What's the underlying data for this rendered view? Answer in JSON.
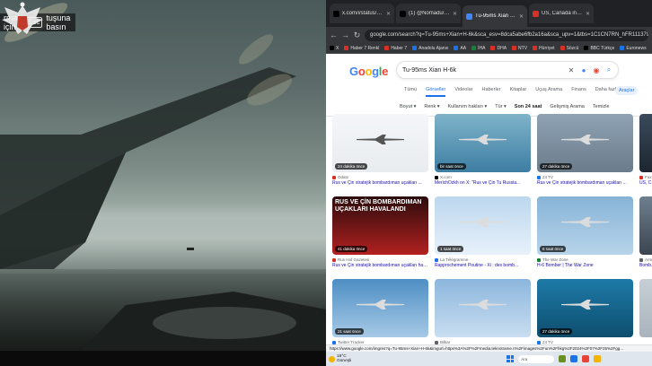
{
  "video": {
    "esc_hint_prefix": "rmak için",
    "esc_key": "Esc",
    "esc_hint_suffix": "tuşuna basın"
  },
  "browser": {
    "tabs": [
      {
        "label": "x.com/i/status/17479...",
        "favicon_color": "#000000",
        "active": false
      },
      {
        "label": "(1) @Nomadu/Türk basını / X",
        "favicon_color": "#000000",
        "active": false
      },
      {
        "label": "Tu-95ms Xian H-6k - Google G...",
        "favicon_color": "#4285f4",
        "active": true
      },
      {
        "label": "US, Canada intercept nuclear-...",
        "favicon_color": "#d93025",
        "active": false
      }
    ],
    "url": "google.com/search?q=Tu-95ms+Xian+H-6k&sca_esv=8dca5abe6fb2a16a&sca_upv=1&tbs=1C1CN7RN_hFR1113791113&udm=2&biw=1536",
    "bookmarks": [
      {
        "label": "X",
        "color": "#000000"
      },
      {
        "label": "Haber 7 Renkl",
        "color": "#d93025"
      },
      {
        "label": "Haber 7",
        "color": "#d93025"
      },
      {
        "label": "Anadolu Ajansı",
        "color": "#1a73e8"
      },
      {
        "label": "AA",
        "color": "#1a73e8"
      },
      {
        "label": "İHA",
        "color": "#188038"
      },
      {
        "label": "DHA",
        "color": "#d93025"
      },
      {
        "label": "NTV",
        "color": "#d93025"
      },
      {
        "label": "Hürriyet",
        "color": "#d93025"
      },
      {
        "label": "Sözcü",
        "color": "#d93025"
      },
      {
        "label": "BBC Türkçe",
        "color": "#000000"
      },
      {
        "label": "Euronews",
        "color": "#1a73e8"
      },
      {
        "label": "DW",
        "color": "#1a73e8"
      }
    ]
  },
  "google": {
    "logo": [
      "G",
      "o",
      "o",
      "g",
      "l",
      "e"
    ],
    "logo_colors": [
      "#4285f4",
      "#ea4335",
      "#fbbc05",
      "#4285f4",
      "#34a853",
      "#ea4335"
    ],
    "query": "Tu-95ms Xian H-6k",
    "tabs": [
      "Tümü",
      "Görseller",
      "Videolar",
      "Haberler",
      "Kitaplar",
      "Uçuş Arama",
      "Finans",
      "Daha fazla"
    ],
    "active_tab": "Görseller",
    "tools_label": "Araçlar",
    "filters": [
      "Boyut",
      "Renk",
      "Kullanım hakları",
      "Tür",
      "Son 24 saat",
      "Gelişmiş Arama",
      "Temizle"
    ],
    "results": [
      {
        "badge": "24 dakika önce",
        "source": "Odatv",
        "title": "Rus ve Çin stratejik bombardıman uçakları ..."
      },
      {
        "badge": "bir saat önce",
        "source": "X.com",
        "title": "MerichOzkh on X: \"Rus ve Çin Tu Russia..."
      },
      {
        "badge": "27 dakika önce",
        "source": "24 TV",
        "title": "Rus ve Çin stratejik bombardıman uçakları ..."
      },
      {
        "badge": "",
        "source": "Fox",
        "title": "US, C..."
      },
      {
        "badge": "41 dakika önce",
        "source": "Rus Haf Gazetesi",
        "title": "Rus ve Çin stratejik bombardıman uçakları havalandı"
      },
      {
        "badge": "1 saat önce",
        "source": "La Télégramme",
        "title": "Rapprochement Poutine - Xi : des bomb..."
      },
      {
        "badge": "6 saat önce",
        "source": "The War Zone",
        "title": "H-6 Bomber | The War Zone"
      },
      {
        "badge": "",
        "source": "Arm",
        "title": "Bomb..."
      },
      {
        "badge": "21 saat önce",
        "source": "Twitter Tracker",
        "title": ""
      },
      {
        "badge": "",
        "source": "Bilkar",
        "title": ""
      },
      {
        "badge": "27 dakika önce",
        "source": "24 TV",
        "title": ""
      },
      {
        "badge": "",
        "source": "",
        "title": ""
      }
    ],
    "banner_text": "RUS VE ÇİN BOMBARDIMAN UÇAKLARI HAVALANDI"
  },
  "status_url": "https://www.google.com/imgres?q=Tu-95ms+Xian+H-6k&imgurl=https%3A%2F%2Fmedia.teknotrame.n%2Fimages%2Fun%2Fhkg%2F2024%2F07%2F25%2Fgg...",
  "taskbar": {
    "temp": "18°C",
    "weather": "Güneşli",
    "search_placeholder": "Ara"
  },
  "icons": {
    "emblem": "eagle-emblem-icon",
    "back": "back-arrow-icon",
    "forward": "forward-arrow-icon",
    "reload": "reload-icon",
    "clear": "close-icon",
    "mic": "microphone-icon",
    "lens": "camera-lens-icon",
    "search": "search-icon"
  }
}
